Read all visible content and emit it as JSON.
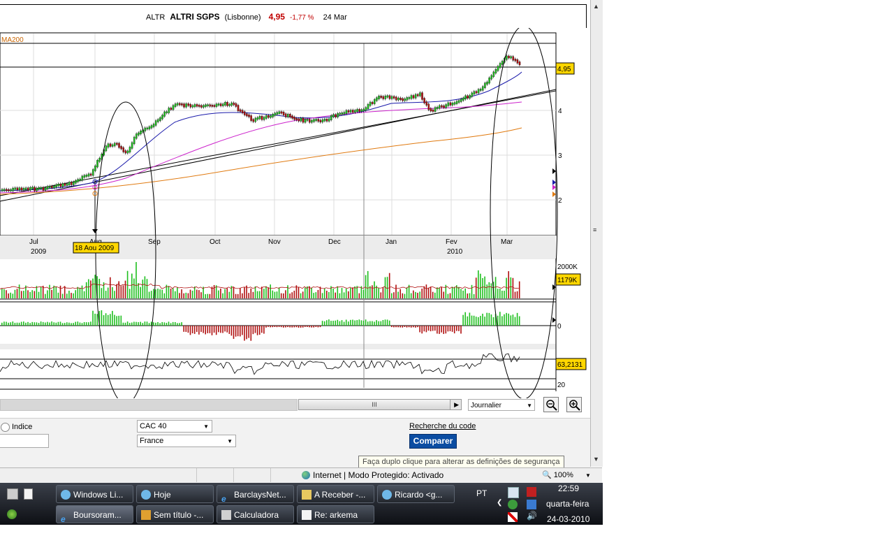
{
  "header": {
    "ticker": "ALTR",
    "name": "ALTRI SGPS",
    "exchange": "(Lisbonne)",
    "price": "4,95",
    "change": "-1,77 %",
    "date": "24 Mar"
  },
  "chart": {
    "ma_label": "MA200",
    "price_label": "4,95",
    "price_ticks": [
      "4",
      "3",
      "2"
    ],
    "months": [
      "Jul",
      "Aug",
      "Sep",
      "Oct",
      "Nov",
      "Dec",
      "Jan",
      "Fev",
      "Mar"
    ],
    "years": [
      "2009",
      "2010"
    ],
    "cursor_date": "18 Aou 2009",
    "volume_max": "2000K",
    "volume_label": "1179K",
    "macd_zero": "0",
    "osc_label": "63,2131",
    "osc_tick": "20"
  },
  "toolbar": {
    "period": "Journalier",
    "thumb": "III"
  },
  "form": {
    "indice_label": "Indice",
    "index_select": "CAC 40",
    "country_select": "France",
    "recherche": "Recherche du code",
    "comparer": "Comparer"
  },
  "browser": {
    "tooltip": "Faça duplo clique para alterar as definições de segurança",
    "zone": "Internet | Modo Protegido: Activado",
    "zoom": "100%"
  },
  "taskbar": {
    "row1": [
      "Windows Li...",
      "Hoje",
      "BarclaysNet...",
      "A Receber -...",
      "Ricardo <g..."
    ],
    "row2": [
      "Boursoram...",
      "Sem título -...",
      "Calculadora",
      "Re: arkema"
    ],
    "lang": "PT",
    "time": "22:59",
    "day": "quarta-feira",
    "date": "24-03-2010"
  },
  "colors": {
    "up": "#1fbf1f",
    "down": "#b01010",
    "ma_short": "#1a1aaa",
    "ma_mid": "#cc22cc",
    "ma_long": "#e07a10",
    "label_bg": "#ffd700"
  }
}
